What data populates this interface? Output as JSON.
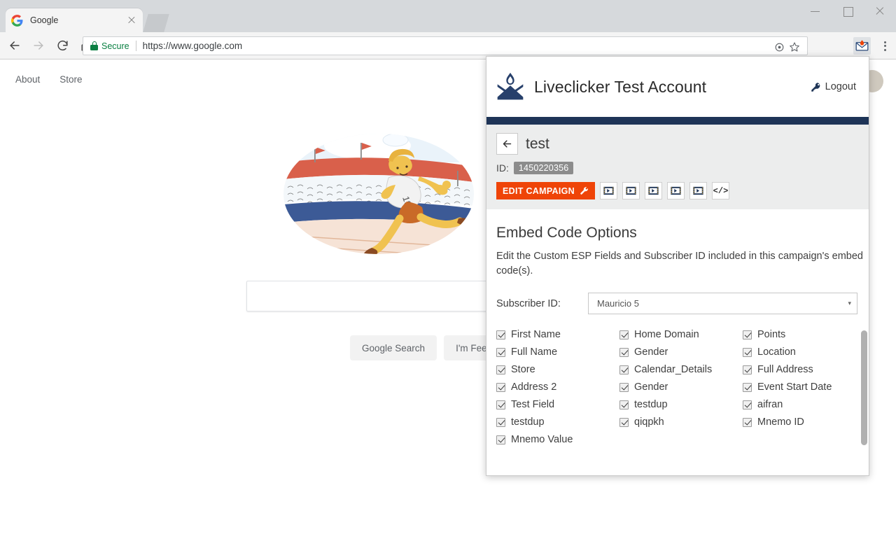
{
  "browser": {
    "tab": {
      "title": "Google",
      "favicon": "google-g-icon",
      "close": "close-icon"
    },
    "nav": {
      "back": "back-arrow-icon",
      "forward": "forward-arrow-icon",
      "reload": "reload-icon",
      "home": "home-icon"
    },
    "omnibox": {
      "security_label": "Secure",
      "url_scheme": "https://",
      "url_host": "www.google.com",
      "full_url": "https://www.google.com"
    },
    "omnibox_icons": [
      "target-icon",
      "star-icon"
    ],
    "extension": {
      "name": "liveclicker-extension-icon"
    },
    "menu": "chrome-menu-icon",
    "window_controls": [
      "minimize",
      "maximize",
      "close"
    ]
  },
  "google_page": {
    "nav_links": [
      "About",
      "Store"
    ],
    "doodle_alt": "google-doodle-runner-stadium",
    "search_placeholder": "",
    "search_value": "",
    "buttons": [
      "Google Search",
      "I'm Feeling Lucky"
    ]
  },
  "popup": {
    "header": {
      "logo": "liveclicker-flame-envelope-logo",
      "account_title": "Liveclicker Test Account",
      "logout_label": "Logout",
      "logout_icon": "key-icon"
    },
    "campaign": {
      "back_icon": "back-arrow-icon",
      "name": "test",
      "id_label": "ID:",
      "id_value": "1450220356",
      "edit_button": "EDIT CAMPAIGN",
      "edit_icon": "wrench-icon",
      "action_icons": [
        "video-embed-icon",
        "video-embed-icon",
        "video-embed-icon",
        "video-embed-icon",
        "video-embed-icon",
        "code-embed-icon"
      ]
    },
    "embed": {
      "title": "Embed Code Options",
      "description": "Edit the Custom ESP Fields and Subscriber ID included in this campaign's embed code(s).",
      "subscriber_label": "Subscriber ID:",
      "subscriber_value": "Mauricio 5",
      "caret": "▾"
    },
    "fields": [
      {
        "label": "First Name",
        "checked": true
      },
      {
        "label": "Home Domain",
        "checked": true
      },
      {
        "label": "Points",
        "checked": true
      },
      {
        "label": "Full Name",
        "checked": true
      },
      {
        "label": "Gender",
        "checked": true
      },
      {
        "label": "Location",
        "checked": true
      },
      {
        "label": "Store",
        "checked": true
      },
      {
        "label": "Calendar_Details",
        "checked": true
      },
      {
        "label": "Full Address",
        "checked": true
      },
      {
        "label": "Address 2",
        "checked": true
      },
      {
        "label": "Gender",
        "checked": true
      },
      {
        "label": "Event Start Date",
        "checked": true
      },
      {
        "label": "Test Field",
        "checked": true
      },
      {
        "label": "testdup",
        "checked": true
      },
      {
        "label": "aifran",
        "checked": true
      },
      {
        "label": "testdup",
        "checked": true
      },
      {
        "label": "qiqpkh",
        "checked": true
      },
      {
        "label": "Mnemo ID",
        "checked": true
      },
      {
        "label": "Mnemo Value",
        "checked": true
      }
    ]
  },
  "colors": {
    "brand_navy": "#1e3457",
    "accent_orange": "#ef4408",
    "secure_green": "#0b8043",
    "panel_gray": "#eceded"
  }
}
